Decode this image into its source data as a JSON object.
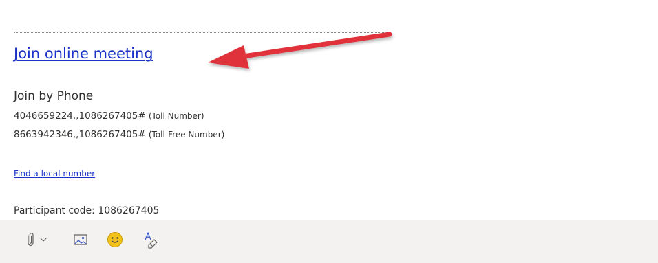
{
  "message": {
    "join_link_label": "Join online meeting",
    "phone_heading": "Join by Phone",
    "phone_lines": [
      {
        "number": "4046659224,,1086267405#",
        "note": "(Toll Number)"
      },
      {
        "number": "8663942346,,1086267405#",
        "note": "(Toll-Free Number)"
      }
    ],
    "local_number_link": "Find a local number",
    "participant_code": "Participant code: 1086267405"
  },
  "toolbar": {
    "items": [
      {
        "name": "attach-file",
        "icon": "paperclip-icon",
        "has_dropdown": true
      },
      {
        "name": "insert-picture",
        "icon": "picture-icon"
      },
      {
        "name": "insert-emoji",
        "icon": "emoji-icon"
      },
      {
        "name": "format-painter",
        "icon": "format-text-icon"
      }
    ]
  },
  "colors": {
    "link": "#1a32c8",
    "text": "#323130",
    "arrow": "#e0313a",
    "toolbar_bg": "#f3f2f1",
    "icon": "#3b5bc8",
    "emoji": "#f2c21b"
  }
}
